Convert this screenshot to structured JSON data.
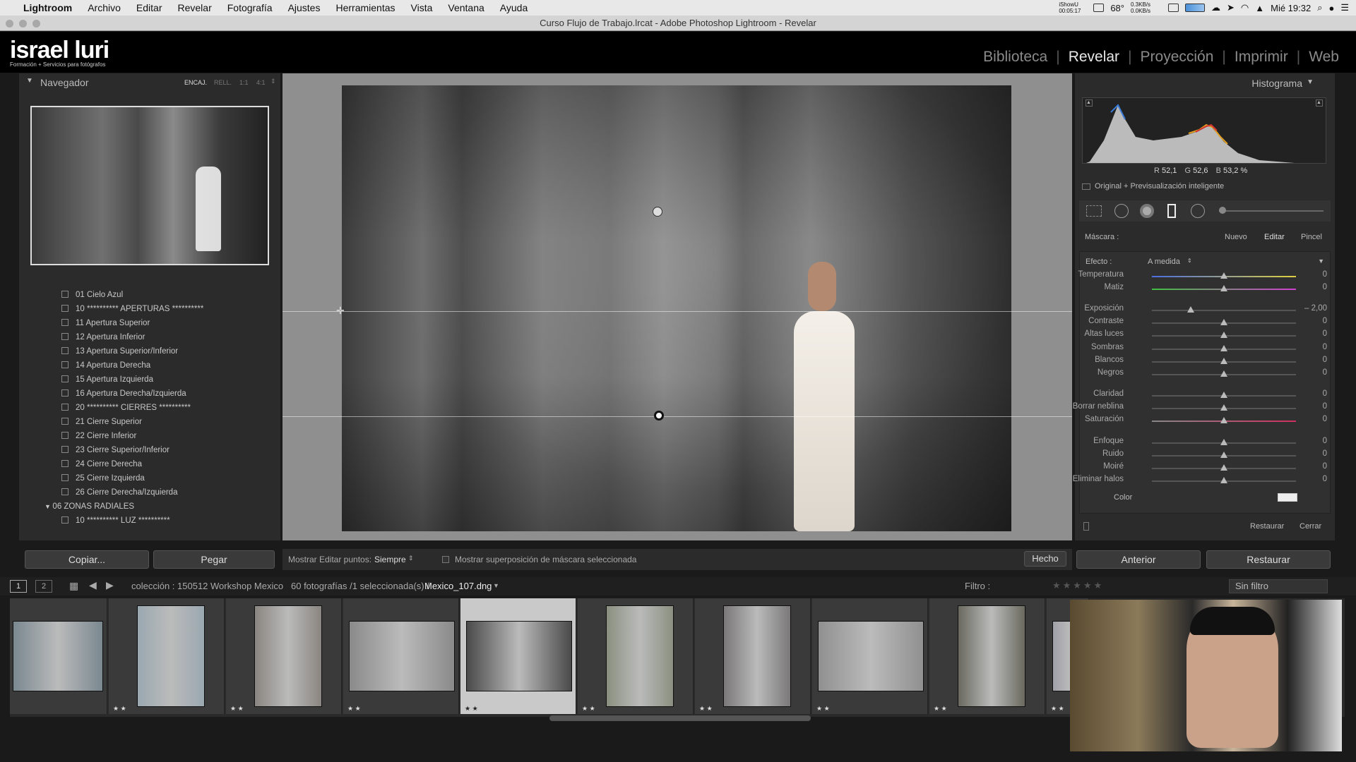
{
  "menubar": {
    "apple": "",
    "app": "Lightroom",
    "items": [
      "Archivo",
      "Editar",
      "Revelar",
      "Fotografía",
      "Ajustes",
      "Herramientas",
      "Vista",
      "Ventana",
      "Ayuda"
    ],
    "status": {
      "temp": "68°",
      "clock": "Mié 19:32",
      "net": "0.3KB/s 0.0KB/s",
      "ishowu": "iShowU 00:05:17"
    }
  },
  "window": {
    "title": "Curso Flujo de Trabajo.lrcat - Adobe Photoshop Lightroom - Revelar"
  },
  "header": {
    "logo_text": "israel luri",
    "logo_sub": "Formación + Servicios para fotógrafos",
    "modules": [
      "Biblioteca",
      "Revelar",
      "Proyección",
      "Imprimir",
      "Web"
    ],
    "active_module": "Revelar"
  },
  "navigator": {
    "title": "Navegador",
    "zoom_options": [
      "ENCAJ.",
      "RELL.",
      "1:1",
      "4:1"
    ]
  },
  "presets": {
    "items": [
      "01 Cielo Azul",
      "10 ********** APERTURAS **********",
      "11 Apertura Superior",
      "12 Apertura Inferior",
      "13 Apertura Superior/Inferior",
      "14 Apertura Derecha",
      "15 Apertura Izquierda",
      "16 Apertura Derecha/Izquierda",
      "20 ********** CIERRES **********",
      "21 Cierre Superior",
      "22 Cierre Inferior",
      "23 Cierre Superior/Inferior",
      "24 Cierre Derecha",
      "25 Cierre Izquierda",
      "26 Cierre Derecha/Izquierda"
    ],
    "folder": "06 ZONAS RADIALES",
    "folder_items": [
      "10 ********** LUZ **********"
    ]
  },
  "left_buttons": {
    "copy": "Copiar...",
    "paste": "Pegar"
  },
  "toolbar": {
    "show_points_label": "Mostrar Editar puntos:",
    "show_points_value": "Siempre",
    "overlay_label": "Mostrar superposición de máscara seleccionada",
    "done": "Hecho"
  },
  "histogram": {
    "title": "Histograma",
    "r_label": "R",
    "r": "52,1",
    "g_label": "G",
    "g": "52,6",
    "b_label": "B",
    "b": "53,2 %",
    "preview": "Original + Previsualización inteligente"
  },
  "mask": {
    "label": "Máscara :",
    "new": "Nuevo",
    "edit": "Editar",
    "brush": "Pincel",
    "effect_label": "Efecto :",
    "effect_value": "A medida"
  },
  "sliders": [
    {
      "label": "Temperatura",
      "value": "0",
      "pos": 0.5
    },
    {
      "label": "Matiz",
      "value": "0",
      "pos": 0.5
    },
    {
      "label": "Exposición",
      "value": "– 2,00",
      "pos": 0.27
    },
    {
      "label": "Contraste",
      "value": "0",
      "pos": 0.5
    },
    {
      "label": "Altas luces",
      "value": "0",
      "pos": 0.5
    },
    {
      "label": "Sombras",
      "value": "0",
      "pos": 0.5
    },
    {
      "label": "Blancos",
      "value": "0",
      "pos": 0.5
    },
    {
      "label": "Negros",
      "value": "0",
      "pos": 0.5
    },
    {
      "label": "Claridad",
      "value": "0",
      "pos": 0.5
    },
    {
      "label": "Borrar neblina",
      "value": "0",
      "pos": 0.5
    },
    {
      "label": "Saturación",
      "value": "0",
      "pos": 0.5
    },
    {
      "label": "Enfoque",
      "value": "0",
      "pos": 0.5
    },
    {
      "label": "Ruido",
      "value": "0",
      "pos": 0.5
    },
    {
      "label": "Moiré",
      "value": "0",
      "pos": 0.5
    },
    {
      "label": "Eliminar halos",
      "value": "0",
      "pos": 0.5
    }
  ],
  "color_label": "Color",
  "panel_actions": {
    "reset": "Restaurar",
    "close": "Cerrar"
  },
  "right_buttons": {
    "prev": "Anterior",
    "reset": "Restaurar"
  },
  "filmstrip_bar": {
    "pages": [
      "1",
      "2"
    ],
    "source": "colección : 150512 Workshop Mexico",
    "count": "60 fotografías /1 seleccionada(s) /",
    "file": "Mexico_107.dng",
    "filter_label": "Filtro :",
    "filter_value": "Sin filtro"
  },
  "thumbs_stars": [
    "",
    "★ ★",
    "★ ★",
    "★ ★",
    "★ ★",
    "★ ★",
    "★ ★",
    "★ ★",
    "★ ★",
    "★ ★"
  ]
}
